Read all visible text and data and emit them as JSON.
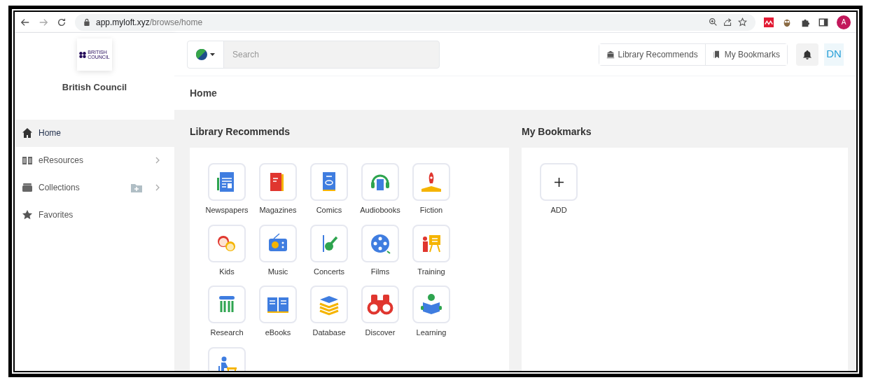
{
  "browser": {
    "url_host": "app.myloft.xyz",
    "url_path": "/browse/home",
    "profile_initial": "A"
  },
  "sidebar": {
    "logo_lines": [
      "BRITISH",
      "COUNCIL"
    ],
    "org_name": "British Council",
    "items": [
      {
        "label": "Home",
        "selected": true,
        "chevron": false,
        "add_folder": false
      },
      {
        "label": "eResources",
        "selected": false,
        "chevron": true,
        "add_folder": false
      },
      {
        "label": "Collections",
        "selected": false,
        "chevron": true,
        "add_folder": true
      },
      {
        "label": "Favorites",
        "selected": false,
        "chevron": false,
        "add_folder": false
      }
    ]
  },
  "search": {
    "placeholder": "Search"
  },
  "header_buttons": [
    "Library Recommends",
    "My Bookmarks"
  ],
  "user_initials": "DN",
  "page_title": "Home",
  "library_recommends": {
    "title": "Library Recommends",
    "tiles": [
      {
        "kind": "labeled",
        "label": "Newspapers"
      },
      {
        "kind": "labeled",
        "label": "Magazines"
      },
      {
        "kind": "labeled",
        "label": "Comics"
      },
      {
        "kind": "labeled",
        "label": "Audiobooks"
      },
      {
        "kind": "labeled",
        "label": "Fiction"
      },
      {
        "kind": "labeled",
        "label": "Kids"
      },
      {
        "kind": "labeled",
        "label": "Music"
      },
      {
        "kind": "labeled",
        "label": "Concerts"
      },
      {
        "kind": "labeled",
        "label": "Films"
      },
      {
        "kind": "labeled",
        "label": "Training"
      },
      {
        "kind": "labeled",
        "label": "Research"
      },
      {
        "kind": "labeled",
        "label": "eBooks"
      },
      {
        "kind": "labeled",
        "label": "Database"
      },
      {
        "kind": "labeled",
        "label": "Discover"
      },
      {
        "kind": "labeled",
        "label": "Learning"
      },
      {
        "kind": "cut_off"
      }
    ]
  },
  "my_bookmarks": {
    "title": "My Bookmarks",
    "add_label": "ADD"
  }
}
